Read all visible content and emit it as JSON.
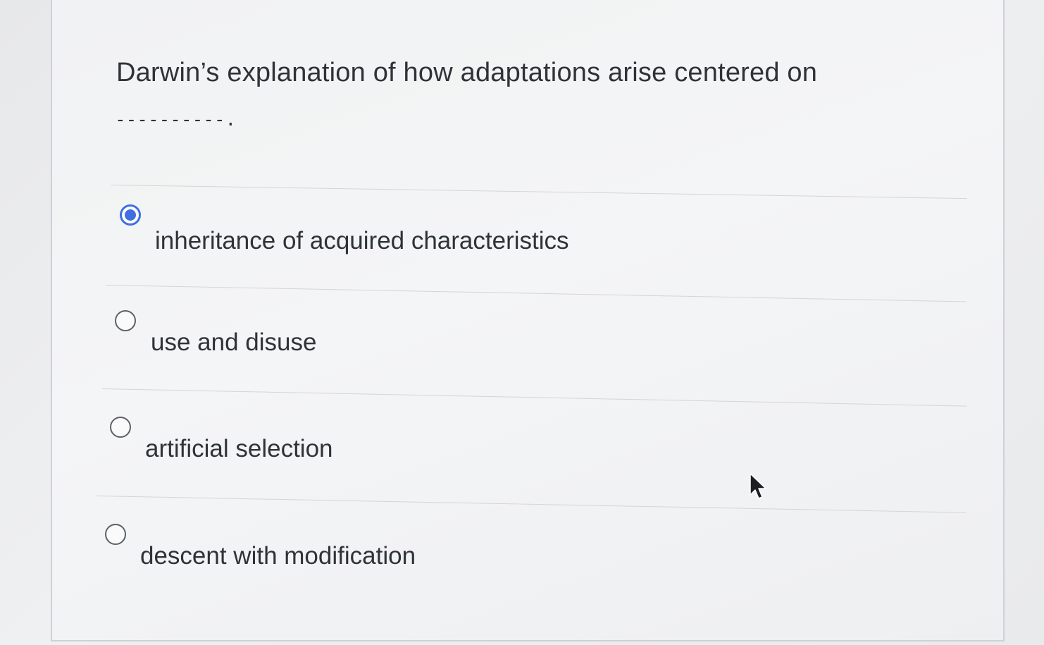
{
  "question": {
    "text": "Darwin’s explanation of how adaptations arise centered on",
    "blank": "----------."
  },
  "options": [
    {
      "label": "inheritance of acquired characteristics",
      "selected": true
    },
    {
      "label": "use and disuse",
      "selected": false
    },
    {
      "label": "artificial selection",
      "selected": false
    },
    {
      "label": "descent with modification",
      "selected": false
    }
  ],
  "colors": {
    "accent": "#3f6fe0",
    "text": "#2f3338",
    "divider": "#d3d5d8"
  },
  "icons": {
    "cursor": "arrow-cursor-icon"
  }
}
